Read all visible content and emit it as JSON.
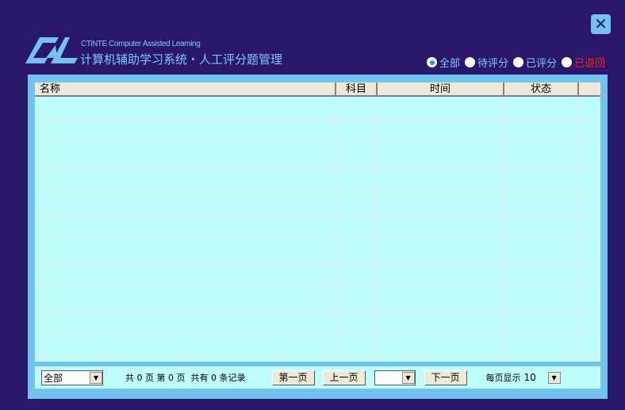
{
  "header": {
    "logo_text": "CAL",
    "subtitle": "CTiNTE Computer Assisted Learning",
    "title": "计算机辅助学习系统・人工评分题管理",
    "close_label": "✕"
  },
  "filters": [
    {
      "label": "全部",
      "selected": true
    },
    {
      "label": "待评分",
      "selected": false
    },
    {
      "label": "已评分",
      "selected": false
    },
    {
      "label": "已退回",
      "selected": false
    }
  ],
  "table": {
    "columns": [
      "名称",
      "科目",
      "时间",
      "状态"
    ],
    "rows": []
  },
  "footer": {
    "scope_select": "全部",
    "total_pages_prefix": "共",
    "total_pages": "0",
    "total_pages_suffix": "页",
    "page_prefix": "第",
    "page": "0",
    "page_suffix": "页",
    "records_prefix": "共有",
    "records": "0",
    "records_suffix": "条记录",
    "first_page": "第一页",
    "prev_page": "上一页",
    "page_select": "",
    "next_page": "下一页",
    "per_page_label": "每页显示",
    "per_page": "10"
  },
  "colors": {
    "background": "#2a176b",
    "accent": "#74c3ee",
    "grid": "#bffdfd",
    "returned": "#ff2020"
  }
}
